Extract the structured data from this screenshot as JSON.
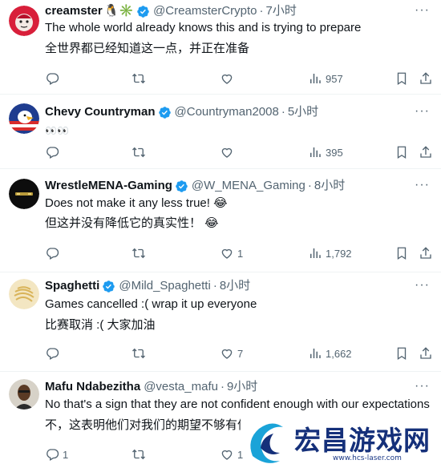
{
  "posts": [
    {
      "name": "creamster",
      "name_emoji": "🐧✳️",
      "handle": "@CreamsterCrypto",
      "time": "7小时",
      "lines": [
        "The whole world already knows this and is trying to prepare",
        "全世界都已经知道这一点，并正在准备"
      ],
      "replies": "",
      "reposts": "",
      "likes": "",
      "views": "957"
    },
    {
      "name": "Chevy Countryman",
      "name_emoji": "",
      "handle": "@Countryman2008",
      "time": "5小时",
      "lines": [
        "👀👀"
      ],
      "replies": "",
      "reposts": "",
      "likes": "",
      "views": "395"
    },
    {
      "name": "WrestleMENA-Gaming",
      "name_emoji": "",
      "handle": "@W_MENA_Gaming",
      "time": "8小时",
      "lines": [
        "Does not make it any less true! 😂",
        "但这并没有降低它的真实性！ 😂"
      ],
      "replies": "",
      "reposts": "",
      "likes": "1",
      "views": "1,792"
    },
    {
      "name": "Spaghetti",
      "name_emoji": "",
      "handle": "@Mild_Spaghetti",
      "time": "8小时",
      "lines": [
        "Games cancelled :( wrap it up everyone",
        "比赛取消 :( 大家加油"
      ],
      "replies": "",
      "reposts": "",
      "likes": "7",
      "views": "1,662"
    },
    {
      "name": "Mafu Ndabezitha",
      "name_emoji": "",
      "handle": "@vesta_mafu",
      "time": "9小时",
      "lines": [
        "No that's a sign that they are not confident enough with our expectations",
        "不，这表明他们对我们的期望不够有信心"
      ],
      "replies": "1",
      "reposts": "",
      "likes": "1",
      "views": ""
    }
  ],
  "separator": "·",
  "more_glyph": "···",
  "watermark": {
    "title": "宏昌游戏网",
    "url": "www.hcs-laser.com"
  },
  "colors": {
    "verified": "#1d9bf0",
    "muted": "#536471",
    "text": "#0f1419"
  }
}
